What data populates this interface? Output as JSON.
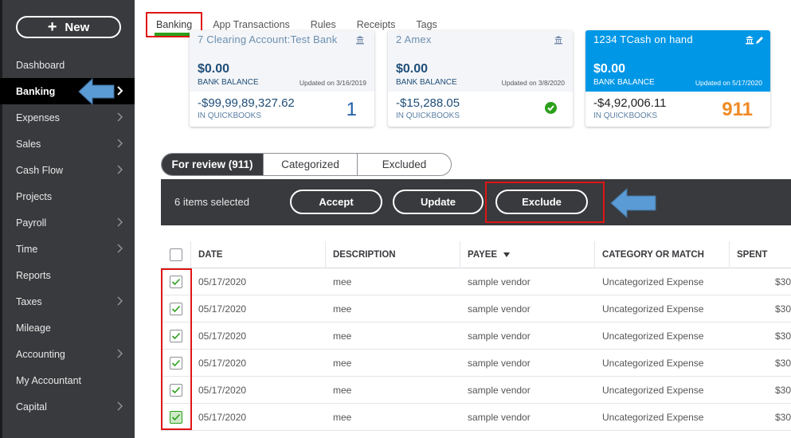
{
  "sidebar": {
    "new_button": "New",
    "items": [
      {
        "label": "Dashboard",
        "chevron": false
      },
      {
        "label": "Banking",
        "chevron": true
      },
      {
        "label": "Expenses",
        "chevron": true
      },
      {
        "label": "Sales",
        "chevron": true
      },
      {
        "label": "Cash Flow",
        "chevron": true
      },
      {
        "label": "Projects",
        "chevron": false
      },
      {
        "label": "Payroll",
        "chevron": true
      },
      {
        "label": "Time",
        "chevron": true
      },
      {
        "label": "Reports",
        "chevron": false
      },
      {
        "label": "Taxes",
        "chevron": true
      },
      {
        "label": "Mileage",
        "chevron": false
      },
      {
        "label": "Accounting",
        "chevron": true
      },
      {
        "label": "My Accountant",
        "chevron": false
      },
      {
        "label": "Capital",
        "chevron": true
      }
    ],
    "active": "Banking"
  },
  "tabs": [
    "Banking",
    "App Transactions",
    "Rules",
    "Receipts",
    "Tags"
  ],
  "cards": [
    {
      "account": "7 Clearing Account:Test Bank",
      "bank_balance": "$0.00",
      "bank_balance_label": "BANK BALANCE",
      "updated": "Updated on 3/16/2019",
      "qb_balance": "-$99,99,89,327.62",
      "qb_label": "IN QUICKBOOKS",
      "count": "1",
      "highlighted": false
    },
    {
      "account": "2 Amex",
      "bank_balance": "$0.00",
      "bank_balance_label": "BANK BALANCE",
      "updated": "Updated on 3/8/2020",
      "qb_balance": "-$15,288.05",
      "qb_label": "IN QUICKBOOKS",
      "count": "",
      "highlighted": false
    },
    {
      "account": "1234 TCash on hand",
      "bank_balance": "$0.00",
      "bank_balance_label": "BANK BALANCE",
      "updated": "Updated on 5/17/2020",
      "qb_balance": "-$4,92,006.11",
      "qb_label": "IN QUICKBOOKS",
      "count": "911",
      "highlighted": true
    }
  ],
  "filters": [
    "For review (911)",
    "Categorized",
    "Excluded"
  ],
  "actionbar": {
    "selected_text": "6 items selected",
    "accept": "Accept",
    "update": "Update",
    "exclude": "Exclude"
  },
  "table": {
    "columns": [
      "DATE",
      "DESCRIPTION",
      "PAYEE",
      "CATEGORY OR MATCH",
      "SPENT"
    ],
    "rows": [
      {
        "date": "05/17/2020",
        "description": "mee",
        "payee": "sample vendor",
        "category": "Uncategorized Expense",
        "spent": "$30"
      },
      {
        "date": "05/17/2020",
        "description": "mee",
        "payee": "sample vendor",
        "category": "Uncategorized Expense",
        "spent": "$30"
      },
      {
        "date": "05/17/2020",
        "description": "mee",
        "payee": "sample vendor",
        "category": "Uncategorized Expense",
        "spent": "$30"
      },
      {
        "date": "05/17/2020",
        "description": "mee",
        "payee": "sample vendor",
        "category": "Uncategorized Expense",
        "spent": "$30"
      },
      {
        "date": "05/17/2020",
        "description": "mee",
        "payee": "sample vendor",
        "category": "Uncategorized Expense",
        "spent": "$30"
      },
      {
        "date": "05/17/2020",
        "description": "mee",
        "payee": "sample vendor",
        "category": "Uncategorized Expense",
        "spent": "$30"
      }
    ]
  },
  "colors": {
    "sidebar_bg": "#393a3d",
    "active_nav_bg": "#000000",
    "brand_green": "#2ca01c",
    "highlight_blue": "#0097e6",
    "annotation_red": "#e01515",
    "arrow_blue": "#5b9bd5",
    "count_orange": "#f08a24"
  }
}
